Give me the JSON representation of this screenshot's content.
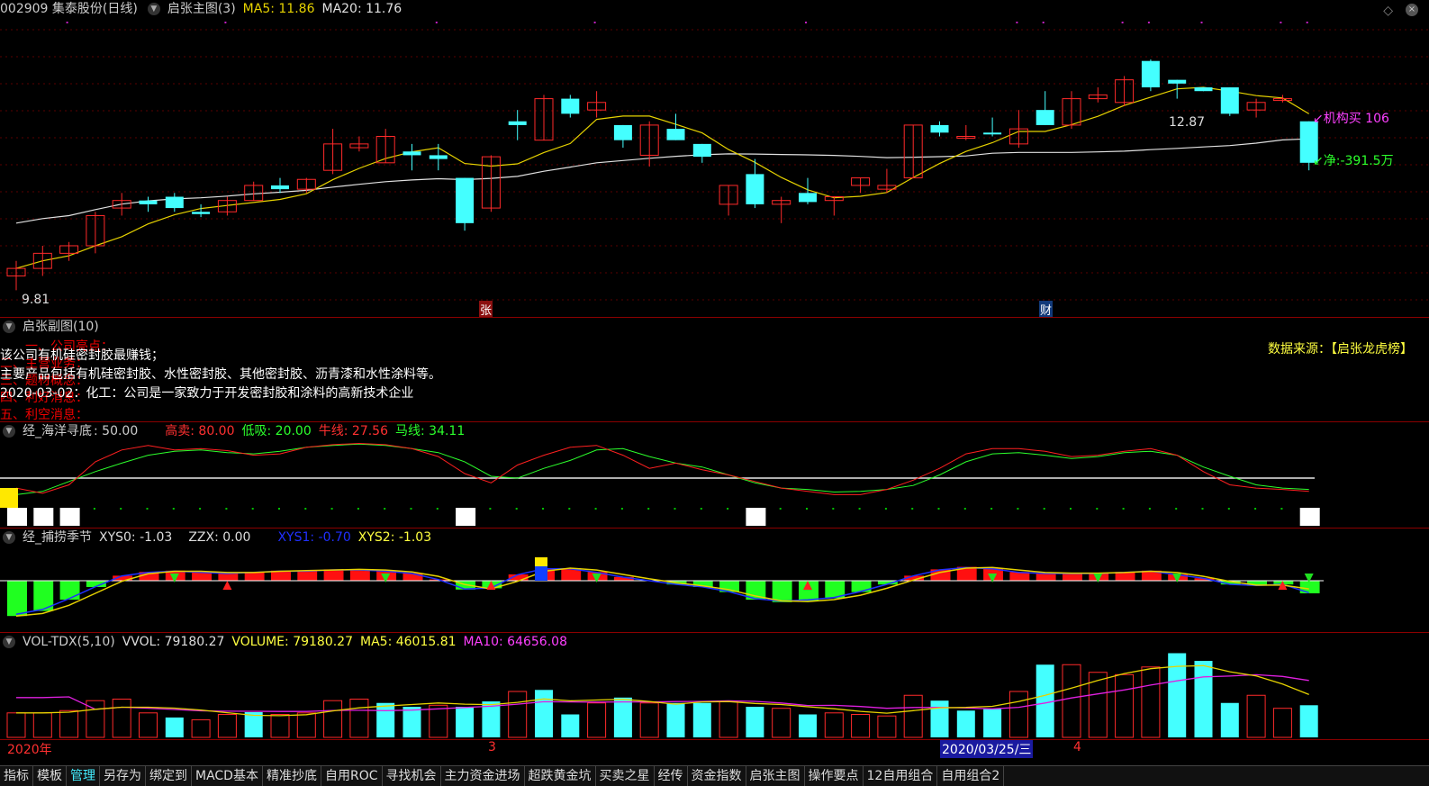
{
  "main": {
    "title": "002909 集泰股份(日线)",
    "indicator": "启张主图(3)",
    "ma5": "MA5: 11.86",
    "ma20": "MA20: 11.76",
    "high_label": "12.87",
    "low_label": "9.81",
    "mark1": "张",
    "mark2": "财",
    "right1": "↙机构买 106",
    "right2": "↙净:-391.5万",
    "colors": {
      "up": "#ff2a2a",
      "down": "#44ffff",
      "ma5": "#e6d200",
      "ma20": "#e0e0e0"
    }
  },
  "candles": [
    [
      10.0,
      10.2,
      9.81,
      10.1
    ],
    [
      10.1,
      10.4,
      10.0,
      10.3
    ],
    [
      10.3,
      10.45,
      10.2,
      10.4
    ],
    [
      10.4,
      10.85,
      10.3,
      10.8
    ],
    [
      10.9,
      11.1,
      10.8,
      11.0
    ],
    [
      11.0,
      11.05,
      10.85,
      10.95
    ],
    [
      11.05,
      11.1,
      10.85,
      10.9
    ],
    [
      10.85,
      10.95,
      10.78,
      10.82
    ],
    [
      10.85,
      11.05,
      10.8,
      11.0
    ],
    [
      11.0,
      11.25,
      11.0,
      11.2
    ],
    [
      11.2,
      11.3,
      11.1,
      11.15
    ],
    [
      11.15,
      11.3,
      11.1,
      11.28
    ],
    [
      11.4,
      11.95,
      11.35,
      11.75
    ],
    [
      11.7,
      11.85,
      11.65,
      11.75
    ],
    [
      11.5,
      11.95,
      11.5,
      11.85
    ],
    [
      11.65,
      11.75,
      11.4,
      11.6
    ],
    [
      11.6,
      11.75,
      11.4,
      11.55
    ],
    [
      11.3,
      11.3,
      10.6,
      10.7
    ],
    [
      10.9,
      11.6,
      10.85,
      11.58
    ],
    [
      12.05,
      12.2,
      11.8,
      12.0
    ],
    [
      11.8,
      12.4,
      11.8,
      12.35
    ],
    [
      12.35,
      12.4,
      12.1,
      12.15
    ],
    [
      12.2,
      12.45,
      12.1,
      12.3
    ],
    [
      12.0,
      12.0,
      11.7,
      11.8
    ],
    [
      11.6,
      12.05,
      11.45,
      12.0
    ],
    [
      11.95,
      12.15,
      11.85,
      11.8
    ],
    [
      11.75,
      11.75,
      11.5,
      11.58
    ],
    [
      10.95,
      11.2,
      10.8,
      11.2
    ],
    [
      11.35,
      11.55,
      10.9,
      10.95
    ],
    [
      10.95,
      11.05,
      10.7,
      11.0
    ],
    [
      11.1,
      11.3,
      10.95,
      10.98
    ],
    [
      11.0,
      11.05,
      10.8,
      11.05
    ],
    [
      11.2,
      11.3,
      11.1,
      11.3
    ],
    [
      11.15,
      11.42,
      11.1,
      11.2
    ],
    [
      11.3,
      12.0,
      11.3,
      12.0
    ],
    [
      12.0,
      12.05,
      11.85,
      11.9
    ],
    [
      11.85,
      12.0,
      11.8,
      11.85
    ],
    [
      11.9,
      12.1,
      11.85,
      11.88
    ],
    [
      11.75,
      12.2,
      11.7,
      11.95
    ],
    [
      12.2,
      12.45,
      12.0,
      12.0
    ],
    [
      12.0,
      12.45,
      11.95,
      12.35
    ],
    [
      12.35,
      12.5,
      12.3,
      12.4
    ],
    [
      12.3,
      12.65,
      12.25,
      12.6
    ],
    [
      12.85,
      12.87,
      12.45,
      12.5
    ],
    [
      12.6,
      12.5,
      12.35,
      12.55
    ],
    [
      12.5,
      12.45,
      12.48,
      12.45
    ],
    [
      12.5,
      12.5,
      12.12,
      12.15
    ],
    [
      12.2,
      12.35,
      12.1,
      12.3
    ],
    [
      12.35,
      12.4,
      12.3,
      12.35
    ],
    [
      12.05,
      12.05,
      11.4,
      11.5
    ]
  ],
  "sub1": {
    "title": "启张副图(10)",
    "ghost": [
      "一、公司亮点：",
      "二、主营业务：",
      "三、题材概念：",
      "四、利好消息：",
      "五、利空消息："
    ],
    "lines": [
      "该公司有机硅密封胶最赚钱；",
      "主要产品包括有机硅密封胶、水性密封胶、其他密封胶、沥青漆和水性涂料等。",
      "2020-03-02：化工：公司是一家致力于开发密封胶和涂料的高新技术企业"
    ],
    "source": "数据来源：【启张龙虎榜】"
  },
  "sub2": {
    "title": "经_海洋寻底",
    "value": ": 50.00",
    "g": "高卖: 80.00",
    "d": "低吸: 20.00",
    "n": "牛线: 27.56",
    "m": "马线: 34.11",
    "red": [
      30,
      22,
      35,
      70,
      88,
      95,
      88,
      90,
      87,
      80,
      82,
      92,
      96,
      98,
      96,
      90,
      78,
      52,
      38,
      65,
      80,
      92,
      95,
      80,
      60,
      68,
      58,
      50,
      40,
      30,
      25,
      20,
      20,
      28,
      42,
      60,
      82,
      90,
      90,
      86,
      78,
      80,
      86,
      90,
      80,
      55,
      35,
      30,
      28,
      25
    ],
    "green": [
      20,
      25,
      40,
      55,
      68,
      80,
      86,
      88,
      84,
      82,
      86,
      92,
      95,
      97,
      95,
      90,
      84,
      70,
      48,
      45,
      60,
      72,
      88,
      90,
      78,
      68,
      62,
      50,
      38,
      30,
      28,
      24,
      25,
      28,
      34,
      50,
      70,
      82,
      84,
      80,
      75,
      78,
      84,
      86,
      80,
      62,
      48,
      35,
      30,
      28
    ]
  },
  "sub3": {
    "title": "经_捕捞季节",
    "xys0": "XYS0: -1.03",
    "zzx": "ZZX: 0.00",
    "xys1": "XYS1: -0.70",
    "xys2": "XYS2: -1.03",
    "hist": [
      -2.8,
      -2.4,
      -1.5,
      -0.5,
      0.4,
      0.7,
      0.8,
      0.7,
      0.6,
      0.7,
      0.8,
      0.8,
      0.9,
      0.9,
      0.8,
      0.6,
      0.1,
      -0.7,
      -0.6,
      0.5,
      1.0,
      1.0,
      0.7,
      0.3,
      0.0,
      -0.3,
      -0.5,
      -0.9,
      -1.5,
      -1.7,
      -1.6,
      -1.4,
      -0.9,
      -0.3,
      0.4,
      0.9,
      1.1,
      1.0,
      0.7,
      0.6,
      0.6,
      0.6,
      0.7,
      0.8,
      0.5,
      0.2,
      -0.3,
      -0.4,
      -0.3,
      -1.0
    ]
  },
  "sub4": {
    "title": "VOL-TDX(5,10)",
    "vvol": "VVOL: 79180.27",
    "volume": "VOLUME: 79180.27",
    "ma5": "MA5: 46015.81",
    "ma10": "MA10: 64656.08",
    "vol": [
      32,
      32,
      35,
      48,
      50,
      32,
      26,
      23,
      30,
      33,
      30,
      32,
      48,
      50,
      45,
      40,
      42,
      40,
      47,
      60,
      62,
      30,
      45,
      52,
      45,
      45,
      45,
      47,
      40,
      38,
      30,
      32,
      30,
      28,
      55,
      48,
      35,
      37,
      60,
      95,
      95,
      85,
      82,
      92,
      110,
      100,
      45,
      55,
      38,
      42,
      90
    ],
    "up": [
      1,
      1,
      1,
      1,
      1,
      1,
      0,
      1,
      1,
      0,
      1,
      1,
      1,
      1,
      0,
      0,
      1,
      0,
      0,
      1,
      0,
      0,
      1,
      0,
      1,
      0,
      0,
      1,
      0,
      1,
      0,
      1,
      1,
      1,
      1,
      0,
      0,
      0,
      1,
      0,
      1,
      1,
      1,
      1,
      0,
      0,
      0,
      1,
      1,
      0
    ],
    "dates": {
      "a": "2020年",
      "b": "3",
      "c": "2020/03/25/三",
      "d": "4"
    }
  },
  "tabs": [
    "指标",
    "模板",
    "管理",
    "另存为",
    "绑定到",
    "MACD基本",
    "精准抄底",
    "自用ROC",
    "寻找机会",
    "主力资金进场",
    "超跌黄金坑",
    "买卖之星",
    "经传",
    "资金指数",
    "启张主图",
    "操作要点",
    "12自用组合",
    "自用组合2"
  ]
}
